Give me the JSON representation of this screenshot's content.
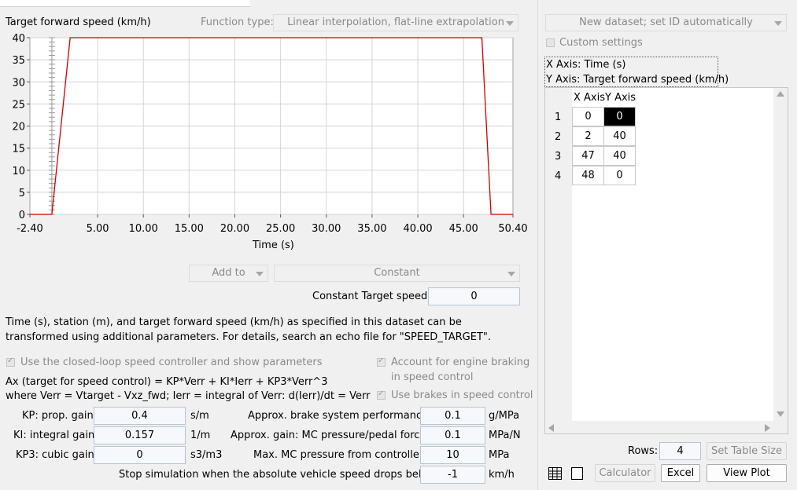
{
  "chart_data": {
    "type": "line",
    "title": "Target forward speed (km/h)",
    "xlabel": "Time (s)",
    "ylabel": "",
    "xlim": [
      -2.4,
      50.4
    ],
    "ylim": [
      0,
      40
    ],
    "x_ticks": [
      "-2.40",
      "5.00",
      "10.00",
      "15.00",
      "20.00",
      "25.00",
      "30.00",
      "35.00",
      "40.00",
      "45.00",
      "50.40"
    ],
    "y_ticks": [
      "0",
      "5",
      "10",
      "15",
      "20",
      "25",
      "30",
      "35",
      "40"
    ],
    "series": [
      {
        "x": [
          -2.4,
          0,
          2,
          47,
          48,
          50.4
        ],
        "y": [
          0,
          0,
          40,
          40,
          0,
          0
        ]
      }
    ],
    "grid": true,
    "color": "#cc0000"
  },
  "function_type": {
    "label": "Function type:",
    "value": "Linear interpolation, flat-line extrapolation"
  },
  "add_to": {
    "value": "Add to",
    "mode": "Constant"
  },
  "constant_target": {
    "label": "Constant Target speed:",
    "value": "0"
  },
  "description": {
    "line1": "Time (s), station (m), and target forward speed (km/h) as specified in this dataset can be",
    "line2": "transformed using additional parameters. For details, search an echo file for \"SPEED_TARGET\"."
  },
  "closed_loop": {
    "label": "Use the closed-loop speed controller and show parameters"
  },
  "engine_braking": {
    "line1": "Account for engine braking",
    "line2": "in speed control"
  },
  "use_brakes": {
    "label": "Use brakes in speed control"
  },
  "formula": {
    "line1": "Ax (target for speed control) = KP*Verr + KI*Ierr  + KP3*Verr^3",
    "line2": "where Verr = Vtarget - Vxz_fwd; Ierr = integral of Verr: d(Ierr)/dt = Verr"
  },
  "params_left": [
    {
      "label": "KP: prop. gain:",
      "value": "0.4",
      "unit": "s/m"
    },
    {
      "label": "KI: integral gain:",
      "value": "0.157",
      "unit": "1/m"
    },
    {
      "label": "KP3: cubic gain:",
      "value": "0",
      "unit": "s3/m3"
    }
  ],
  "params_right": [
    {
      "label": "Approx. brake system performance:",
      "value": "0.1",
      "unit": "g/MPa"
    },
    {
      "label": "Approx. gain: MC pressure/pedal force:",
      "value": "0.1",
      "unit": "MPa/N"
    },
    {
      "label": "Max. MC pressure from controller:",
      "value": "10",
      "unit": "MPa"
    }
  ],
  "stop_sim": {
    "label": "Stop simulation when the absolute vehicle speed drops below:",
    "value": "-1",
    "unit": "km/h"
  },
  "dataset": {
    "value": "New dataset; set ID automatically"
  },
  "custom_settings": {
    "label": "Custom settings"
  },
  "axis_info": {
    "x": "X Axis: Time (s)",
    "y": "Y Axis: Target forward speed (km/h)"
  },
  "table": {
    "headers": [
      "X Axis",
      "Y Axis"
    ],
    "rows": [
      {
        "n": "1",
        "x": "0",
        "y": "0"
      },
      {
        "n": "2",
        "x": "2",
        "y": "40"
      },
      {
        "n": "3",
        "x": "47",
        "y": "40"
      },
      {
        "n": "4",
        "x": "48",
        "y": "0"
      }
    ]
  },
  "rows_control": {
    "label": "Rows:",
    "value": "4",
    "button": "Set Table Size"
  },
  "buttons": {
    "calculator": "Calculator",
    "excel": "Excel",
    "view_plot": "View Plot"
  }
}
